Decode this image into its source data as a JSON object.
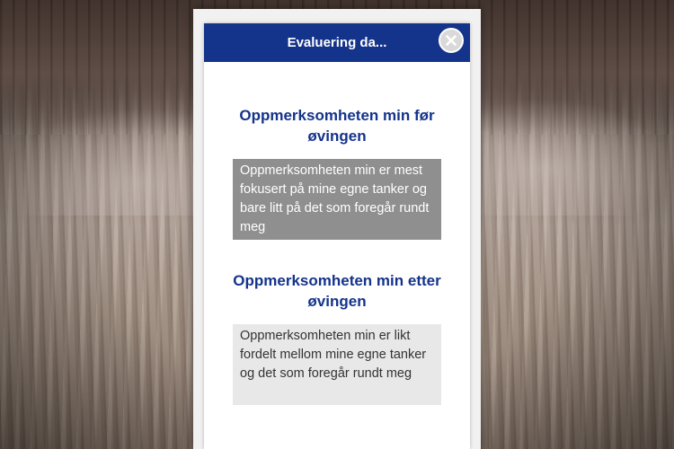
{
  "dialog": {
    "title": "Evaluering da...",
    "close_icon": "close-icon"
  },
  "before": {
    "heading": "Oppmerksomheten min før øvingen",
    "answer": "Oppmerksomheten min er mest fokusert på mine egne tanker og bare litt på det som foregår rundt meg"
  },
  "after": {
    "heading": "Oppmerksomheten min etter øvingen",
    "answer": "Oppmerksomheten min er likt fordelt mellom mine egne tanker og det som foregår rundt meg"
  },
  "colors": {
    "header": "#14338a",
    "heading_text": "#14338a",
    "answer_before_bg": "#8f8f8f",
    "answer_after_bg": "#e8e8e8"
  }
}
